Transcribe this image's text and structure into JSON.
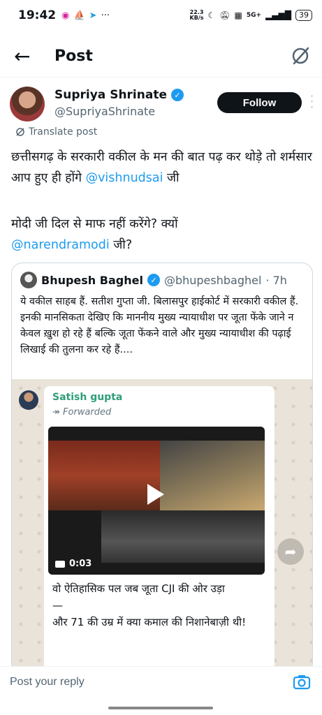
{
  "status_bar": {
    "time": "19:42",
    "net_speed_value": "22.3",
    "net_speed_unit": "KB/s",
    "network": "5G+",
    "battery": "39"
  },
  "header": {
    "title": "Post"
  },
  "post": {
    "author_name": "Supriya Shrinate",
    "author_handle": "@SupriyaShrinate",
    "follow_label": "Follow",
    "translate_label": "Translate post",
    "line1": "छत्तीसगढ़ के सरकारी वकील के मन की बात पढ़ कर थोड़े तो शर्मसार आप हुए ही होंगे ",
    "mention1": "@vishnudsai",
    "line1_end": " जी",
    "line2_start": "मोदी जी दिल से माफ नहीं करेंगे? क्यों",
    "mention2": "@narendramodi",
    "line2_end": " जी?"
  },
  "quoted": {
    "author_name": "Bhupesh Baghel",
    "author_handle": "@bhupeshbaghel",
    "time": " · 7h",
    "text1": "ये वकील साहब हैं. सतीश गुप्ता जी. बिलासपुर हाईकोर्ट में सरकारी वकील हैं.",
    "text2": "इनकी मानसिकता देखिए कि माननीय मुख्य न्यायाधीश पर जूता फेंके जाने न केवल ख़ुश हो रहे हैं बल्कि जूता फेंकने वाले और मुख्य न्यायाधीश की पढ़ाई लिखाई की तुलना कर रहे हैं....",
    "wa_sender": "Satish gupta",
    "wa_forwarded": "Forwarded",
    "video_duration": "0:03",
    "wa_caption1": "वो ऐतिहासिक पल जब जूता CJI की ओर उड़ा",
    "wa_caption2": "और 71 की उम्र में क्या कमाल की निशानेबाज़ी थी!"
  },
  "reply": {
    "placeholder": "Post your reply"
  }
}
